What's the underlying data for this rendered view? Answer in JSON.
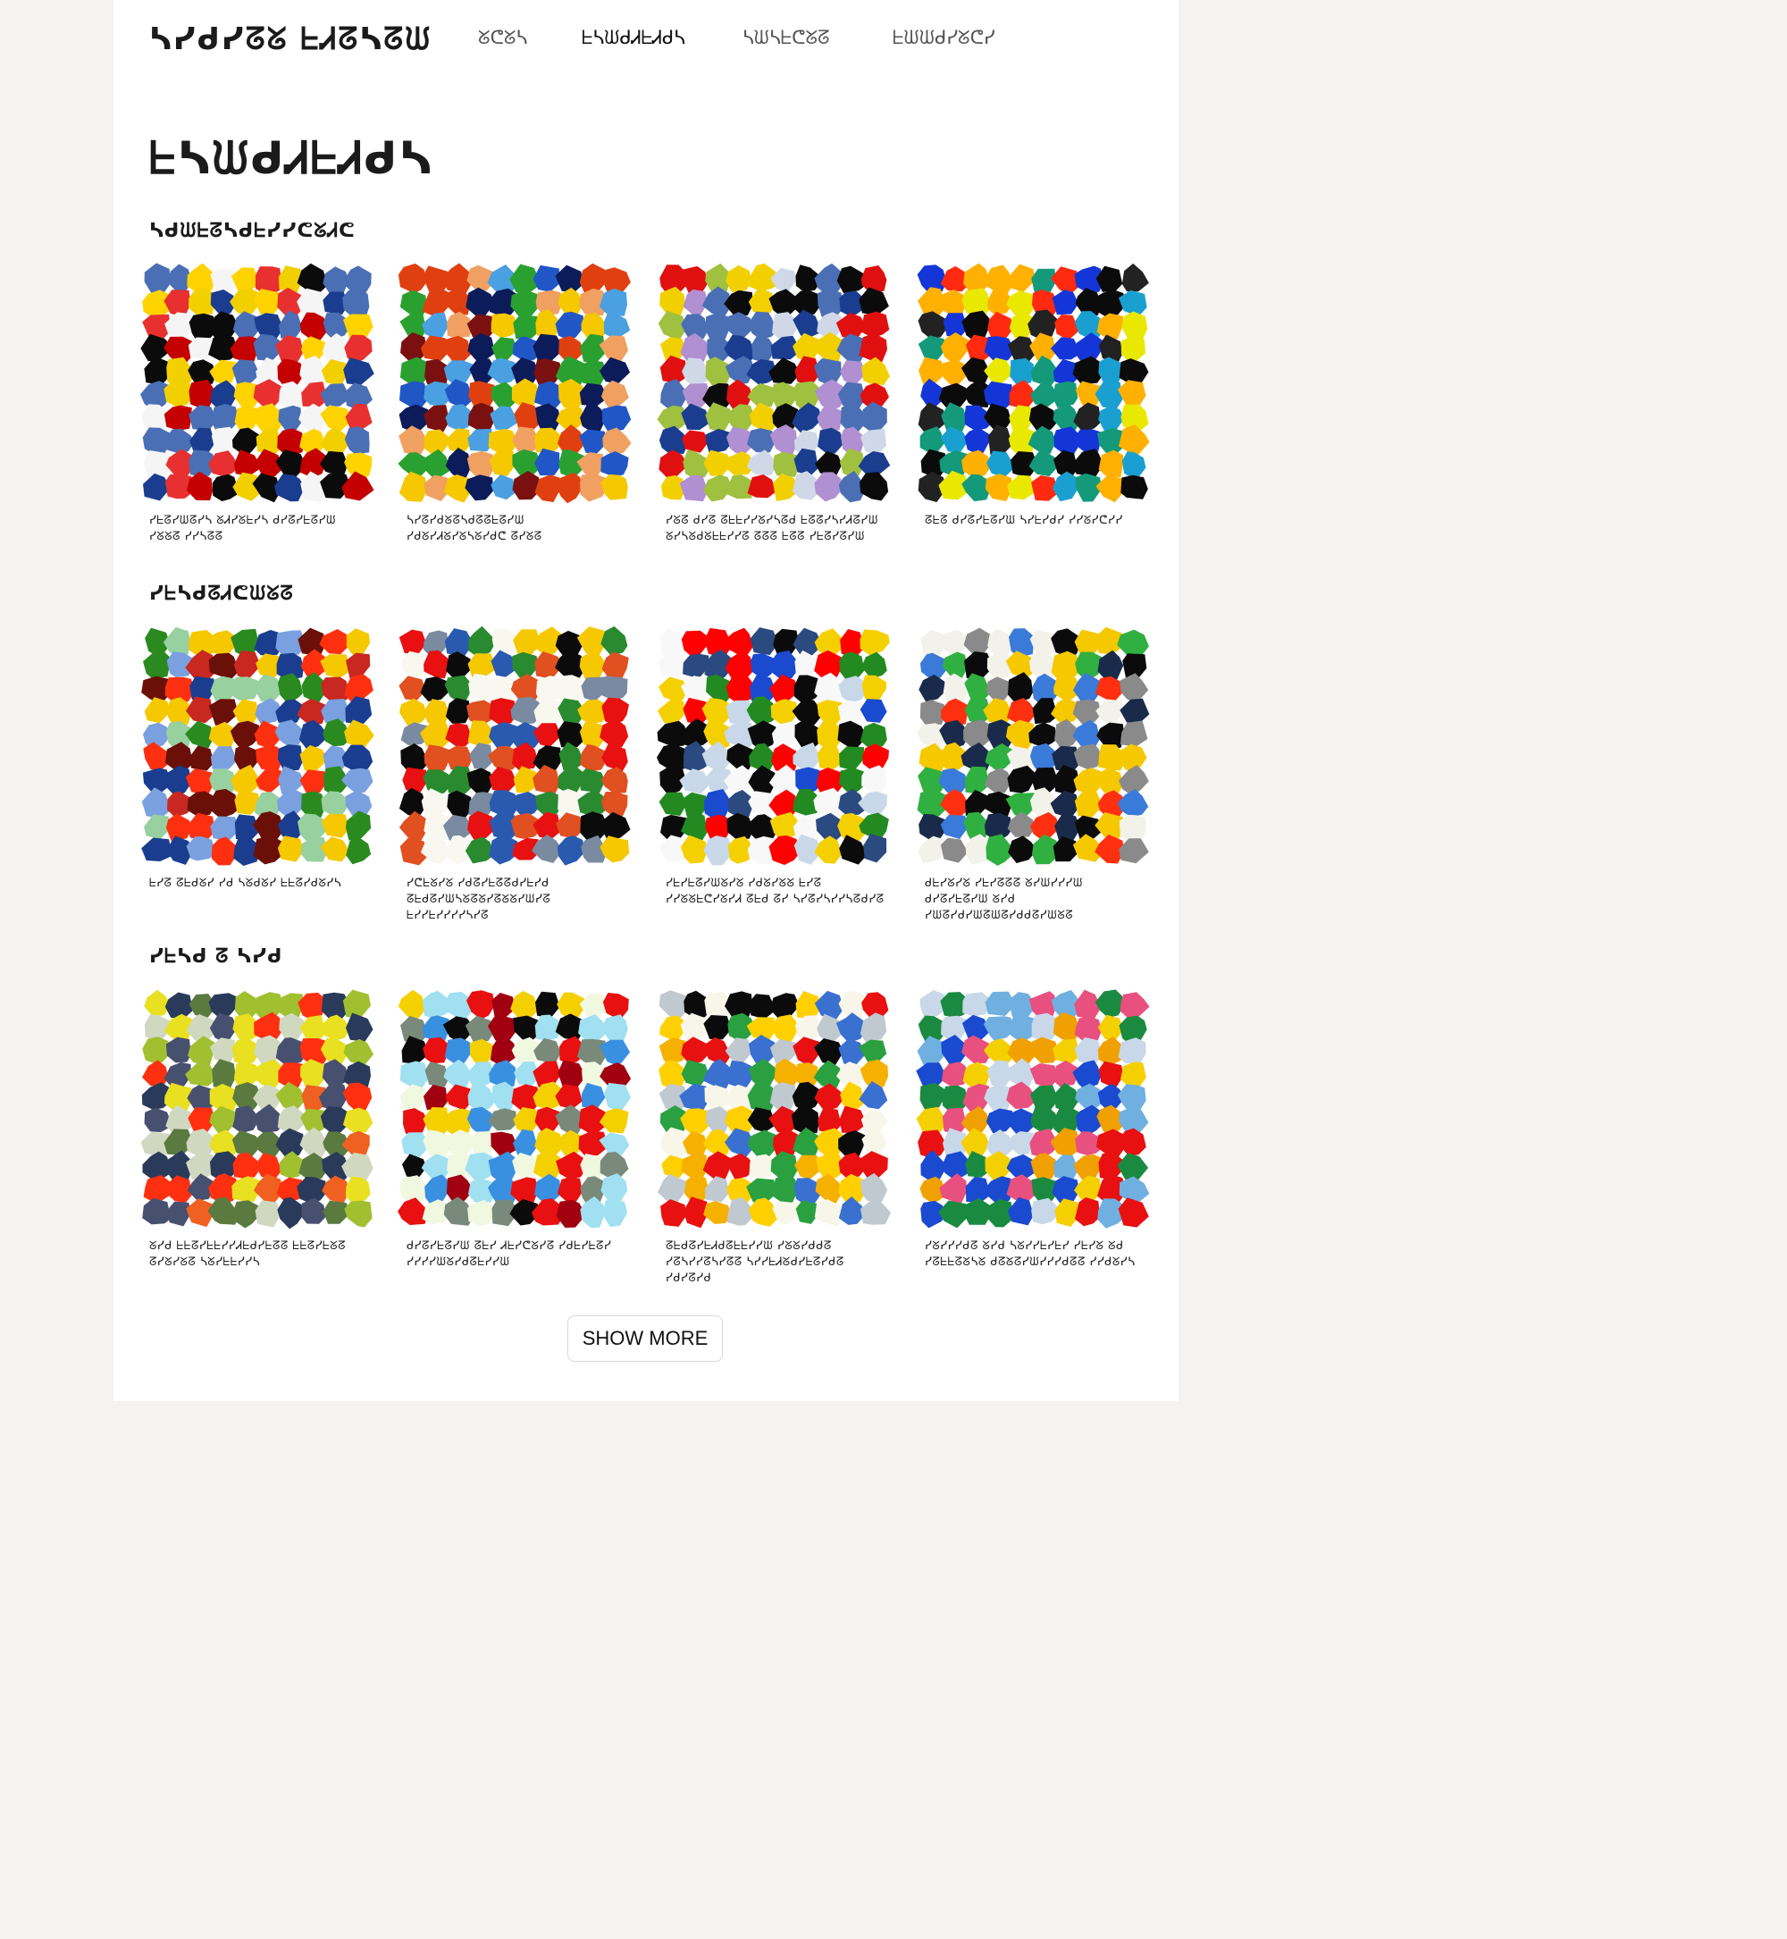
{
  "header": {
    "brand": "ᓴᓯᑯᓯᘔᘜ ᖶᏗᘔᓴᘔᙎ",
    "nav": [
      {
        "label": "ᘜᕦᘜᓴ",
        "active": false
      },
      {
        "label": "ᖶᓴᙎᑯᏗᖶᏗᑯᓴ",
        "active": true
      },
      {
        "label": "ᓴᙎᓴᖶᕦᘜᘔ",
        "active": false
      },
      {
        "label": "ᖶᙎᙎᑯᓯᘜᕦᓯ",
        "active": false
      }
    ]
  },
  "page_title": "ᖶᓴᙎᑯᏗᖶᏗᑯᓴ",
  "sections": [
    {
      "title": "ᓴᑯᙎᖶᘔᓴᑯᖶᓯᓯᕦᘜᏗᕦ",
      "items": [
        {
          "caption": "ᓯᖶᘔᓯᙎᘔᓯᓴ ᘜᏗᓯᘜᖶᓯᓴ ᑯᓯᘔᓯᖶᘔᓯᙎ ᓯᘜᘜᘔ ᓯᓯᓴᘔᘔ",
          "palette": [
            "#c40000",
            "#f2d000",
            "#1a3d8f",
            "#0b0b0b",
            "#f5f5f5",
            "#e83030",
            "#ffd300",
            "#4a6fb5"
          ]
        },
        {
          "caption": "ᓴᓯᘔᓯᑯᘜᘔᓴᑯᘔᘔᖶᘔᓯᙎ ᓯᑯᘜᓯᏗᘜᓯᘜᓴᘜᓯᑯᕦ ᘔᓯᘜᘔ",
          "palette": [
            "#2156c6",
            "#e04010",
            "#4aa0e0",
            "#f5c800",
            "#7a1010",
            "#2aa030",
            "#f0a060",
            "#0c1b5a"
          ]
        },
        {
          "caption": "ᓯᘜᘔ ᑯᓯᘔ ᘔᖶᖶᓯᓯᘜᓯᓴᘔᑯ ᖶᘔᘔᓯᓴᓯᏗᘔᓯᙎ ᘜᓯᓴᘜᑯᘜᖶᖶᓯᓯᘔ ᘔᘔᘔ ᖶᘔᘔ ᓯᖶᘔᓯᘔᓯᙎ",
          "palette": [
            "#f2d000",
            "#e01010",
            "#1a3d8f",
            "#0b0b0b",
            "#a0c040",
            "#b090d0",
            "#d0d8e8",
            "#4a6fb5"
          ]
        },
        {
          "caption": "ᘔᖶᘔ ᑯᓯᘔᓯᖶᘔᓯᙎ ᓴᓯᖶᓯᑯᓯ ᓯᓯᘜᓯᕦᓯᓯ",
          "palette": [
            "#ffb000",
            "#1436d8",
            "#e8e800",
            "#0b0b0b",
            "#ff2a10",
            "#149a7a",
            "#1aa0d0",
            "#222222"
          ]
        }
      ]
    },
    {
      "title": "ᓯᖶᓴᑯᘔᏗᕦᙎᘜᘔ",
      "items": [
        {
          "caption": "ᖶᓯᘔ ᘔᖶᑯᘜᓯ ᓯᑯ ᓴᘜᑯᘜᓯ ᖶᖶᘔᓯᑯᘜᓯᓴ",
          "palette": [
            "#ff3010",
            "#1a3d8f",
            "#f5c800",
            "#2a8a20",
            "#6a1008",
            "#c82820",
            "#7aa0e0",
            "#98d0a0"
          ]
        },
        {
          "caption": "ᓯᕦᖶᘜᓯᘜ ᓯᑯᘔᓯᖶᘔᘔᑯᓯᖶᓯᑯ ᘔᖶᑯᘔᓯᙎᓴᘜᘔᘜᓯᘔᘜᘜᓯᙎᓯᘔ ᖶᓯᓯᖶᓯᓯᓯᓯᓴᓯᘔ",
          "palette": [
            "#e81010",
            "#2a5ab0",
            "#0b0b0b",
            "#f5c800",
            "#f8f8f0",
            "#2a8a30",
            "#7a8aa0",
            "#e05020"
          ]
        },
        {
          "caption": "ᓯᖶᓯᖶᘔᓯᙎᘜᓯᘜ ᓯᑯᘜᓯᘜᘜ ᖶᓯᘔ ᓯᓯᘜᘜᖶᕦᓯᘜᓯᏗ ᘔᖶᑯ ᘔᓯ ᓴᓯᘔᓯᓴᓯᓯᓴᘔᑯᓯᘔ",
          "palette": [
            "#ff0000",
            "#1a4ad0",
            "#f5d000",
            "#2a4a80",
            "#0b0b0b",
            "#228a20",
            "#f8f8f8",
            "#c8d8e8"
          ]
        },
        {
          "caption": "ᑯᖶᓯᘜᓯᘜ ᓯᖶᓯᘔᘔᘔ ᘜᓯᙎᓯᓯᓯᙎ ᑯᓯᘔᓯᖶᘔᓯᙎ ᘜᓯᑯ ᓯᙎᘔᓯᑯᓯᙎᘔᙎᘔᓯᑯᑯᘔᓯᙎᘜᘔ",
          "palette": [
            "#0b0b0b",
            "#3a7ad8",
            "#ff3010",
            "#f2f2ea",
            "#f5c800",
            "#1a2a4a",
            "#30b040",
            "#8a8a8a"
          ]
        }
      ]
    },
    {
      "title": "ᓯᖶᓴᑯ ᘔ ᓴᓯᑯ",
      "items": [
        {
          "caption": "ᘜᓯᑯ ᖶᖶᘔᓯᖶᖶᓯᓯᏗᖶᑯᓯᖶᘔᘔ ᖶᖶᘔᓯᖶᘜᘔ ᘔᓯᘜᓯᘜᘔ ᓴᘜᓯᖶᖶᓯᓯᓴ",
          "palette": [
            "#2a3a5a",
            "#a0c030",
            "#ff3010",
            "#5a7a40",
            "#d0d8c0",
            "#e8e020",
            "#485070",
            "#f06020"
          ]
        },
        {
          "caption": "ᑯᓯᘔᓯᖶᘔᓯᙎ ᘔᖶᓯ Ꮧᖶᓯᕦᘜᓯᘔ ᓯᑯᖶᓯᖶᘔᓯ ᓯᓯᓯᓯᙎᘜᓯᑯᘔᖶᓯᓯᙎ",
          "palette": [
            "#e81010",
            "#3a90e0",
            "#0b0b0b",
            "#f0f8e0",
            "#a0e0f0",
            "#a00010",
            "#f5d000",
            "#7a8a7a"
          ]
        },
        {
          "caption": "ᘔᖶᑯᘔᓯᖶᏗᑯᘔᖶᖶᓯᓯᙎ ᓯᘜᘜᓯᑯᑯᘔ ᓯᘔᓴᓯᓯᘔᓴᓯᘔᘔ ᓴᓯᓯᖶᏗᘜᑯᓯᖶᘔᓯᑯᘔ ᓯᑯᓯᘔᓯᑯ",
          "palette": [
            "#0b0b0b",
            "#f8f6e8",
            "#e81010",
            "#2aa040",
            "#f5b000",
            "#3a70d0",
            "#c0c8d0",
            "#ffd000"
          ]
        },
        {
          "caption": "ᓯᘜᓯᓯᓯᑯᘔ ᘜᓯᑯ ᓴᘜᓯᓯᖶᓯᖶᓯ ᓯᖶᓯᘜ ᘜᑯ ᓯᘔᖶᖶᘔᘜᓴᘜ ᑯᘔᘜᘔᓯᙎᓯᓯᓯᑯᘔᘔ ᓯᓯᑯᘜᓯᓴ",
          "palette": [
            "#1a4ad0",
            "#e81010",
            "#f5d000",
            "#1a8a40",
            "#70b0e0",
            "#f0a000",
            "#c8d8e8",
            "#e85080"
          ]
        }
      ]
    }
  ],
  "show_more_label": "SHOW MORE"
}
